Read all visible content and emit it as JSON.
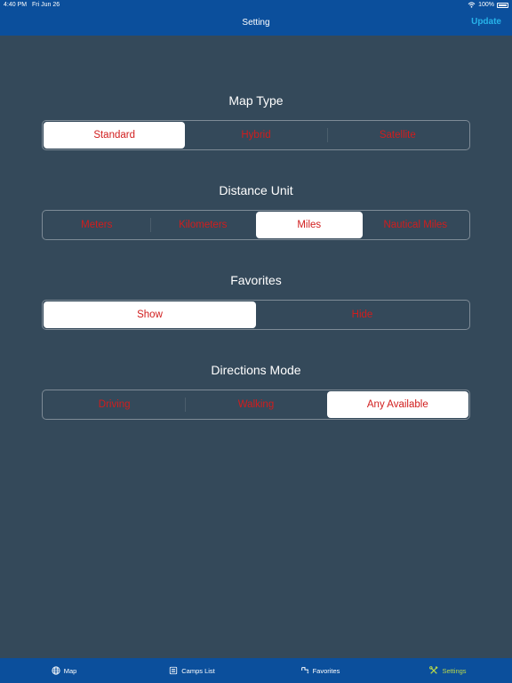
{
  "status_bar": {
    "time": "4:40 PM",
    "date": "Fri Jun 26",
    "battery": "100%"
  },
  "nav": {
    "title": "Setting",
    "action": "Update"
  },
  "sections": [
    {
      "title": "Map Type",
      "options": [
        "Standard",
        "Hybrid",
        "Satellite"
      ],
      "selected": 0
    },
    {
      "title": "Distance Unit",
      "options": [
        "Meters",
        "Kilometers",
        "Miles",
        "Nautical Miles"
      ],
      "selected": 2
    },
    {
      "title": "Favorites",
      "options": [
        "Show",
        "Hide"
      ],
      "selected": 0
    },
    {
      "title": "Directions Mode",
      "options": [
        "Driving",
        "Walking",
        "Any Available"
      ],
      "selected": 2
    }
  ],
  "tabs": [
    {
      "label": "Map",
      "icon": "globe-icon"
    },
    {
      "label": "Camps List",
      "icon": "list-icon"
    },
    {
      "label": "Favorites",
      "icon": "favorites-icon"
    },
    {
      "label": "Settings",
      "icon": "tools-icon",
      "active": true
    }
  ],
  "colors": {
    "bar": "#0b4f9c",
    "background": "#34495a",
    "accent": "#27b3ea",
    "segment_text": "#d11d1d",
    "active_tab": "#b9d94b"
  }
}
